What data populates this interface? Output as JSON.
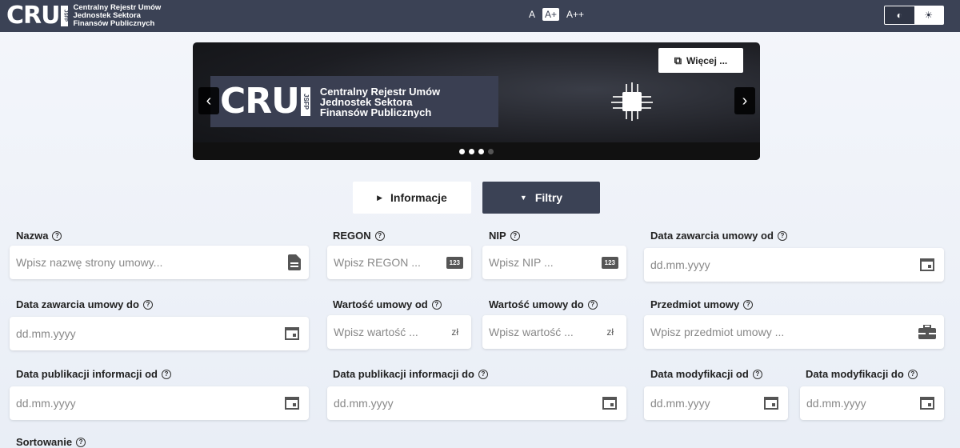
{
  "header": {
    "logo": "CRU",
    "logo_badge": "JSFP",
    "subtitle_lines": [
      "Centralny Rejestr Umów",
      "Jednostek Sektora",
      "Finansów Publicznych"
    ],
    "font_sizes": [
      "A",
      "A+",
      "A++"
    ],
    "active_font_size": "A+"
  },
  "banner": {
    "logo": "CRU",
    "logo_badge": "JSFP",
    "subtitle_lines": [
      "Centralny Rejestr Umów",
      "Jednostek Sektora",
      "Finansów Publicznych"
    ],
    "more_label": "Więcej ...",
    "prev_glyph": "‹",
    "next_glyph": "›",
    "slides": 4,
    "active_slide": 3
  },
  "toggles": {
    "info_label": "Informacje",
    "filter_label": "Filtry"
  },
  "form": {
    "nazwa": {
      "label": "Nazwa",
      "placeholder": "Wpisz nazwę strony umowy..."
    },
    "regon": {
      "label": "REGON",
      "placeholder": "Wpisz REGON ...",
      "badge": "123"
    },
    "nip": {
      "label": "NIP",
      "placeholder": "Wpisz NIP ...",
      "badge": "123"
    },
    "data_zawarcia_od": {
      "label": "Data zawarcia umowy od",
      "placeholder": "dd.mm.yyyy"
    },
    "data_zawarcia_do": {
      "label": "Data zawarcia umowy do",
      "placeholder": "dd.mm.yyyy"
    },
    "wartosc_od": {
      "label": "Wartość umowy od",
      "placeholder": "Wpisz wartość ...",
      "unit": "zł"
    },
    "wartosc_do": {
      "label": "Wartość umowy do",
      "placeholder": "Wpisz wartość ...",
      "unit": "zł"
    },
    "przedmiot": {
      "label": "Przedmiot umowy",
      "placeholder": "Wpisz przedmiot umowy ..."
    },
    "publikacja_od": {
      "label": "Data publikacji informacji od",
      "placeholder": "dd.mm.yyyy"
    },
    "publikacja_do": {
      "label": "Data publikacji informacji do",
      "placeholder": "dd.mm.yyyy"
    },
    "modyfikacja_od": {
      "label": "Data modyfikacji od",
      "placeholder": "dd.mm.yyyy"
    },
    "modyfikacja_do": {
      "label": "Data modyfikacji do",
      "placeholder": "dd.mm.yyyy"
    },
    "sortowanie": {
      "label": "Sortowanie"
    }
  },
  "help_glyph": "?",
  "colors": {
    "primary": "#3b4255",
    "background": "#eef2f8"
  }
}
